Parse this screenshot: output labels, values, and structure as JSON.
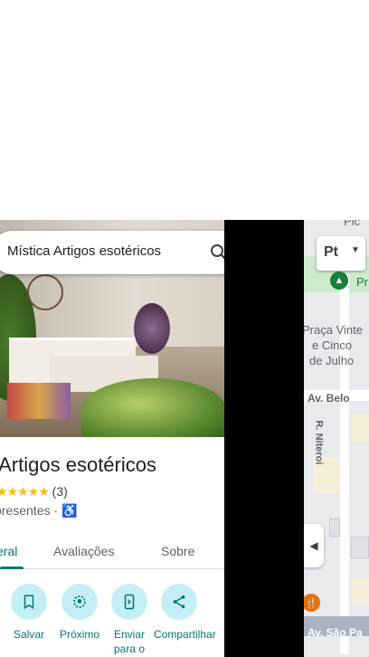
{
  "search": {
    "query": "Mística Artigos esotéricos"
  },
  "place": {
    "name": "ca Artigos esotéricos",
    "stars": "★★★★★",
    "review_count": "(3)",
    "category": "presentes",
    "separator": "·",
    "accessibility_icon": "♿"
  },
  "tabs": [
    {
      "label": "eral",
      "active": true
    },
    {
      "label": "Avaliações",
      "active": false
    },
    {
      "label": "Sobre",
      "active": false
    }
  ],
  "actions": [
    {
      "label": "Salvar",
      "icon": "bookmark-icon"
    },
    {
      "label": "Próximo",
      "icon": "nearby-icon"
    },
    {
      "label": "Enviar para o",
      "icon": "send-to-phone-icon"
    },
    {
      "label": "Compartilhar",
      "icon": "share-icon"
    }
  ],
  "map": {
    "layer_label": "Pt",
    "labels": {
      "top_cut": "Pic",
      "park_cut": "Pr",
      "square_line1": "Praça Vinte",
      "square_line2": "e Cinco",
      "square_line3": "de Julho",
      "avenue_belo": "Av. Belo",
      "street_vertical": "R. Niteroi",
      "avenue_sao_paulo": "Av. São Pa"
    }
  },
  "colors": {
    "accent": "#01796f",
    "action_bg": "#c5eff6",
    "star": "#fbbc04"
  }
}
